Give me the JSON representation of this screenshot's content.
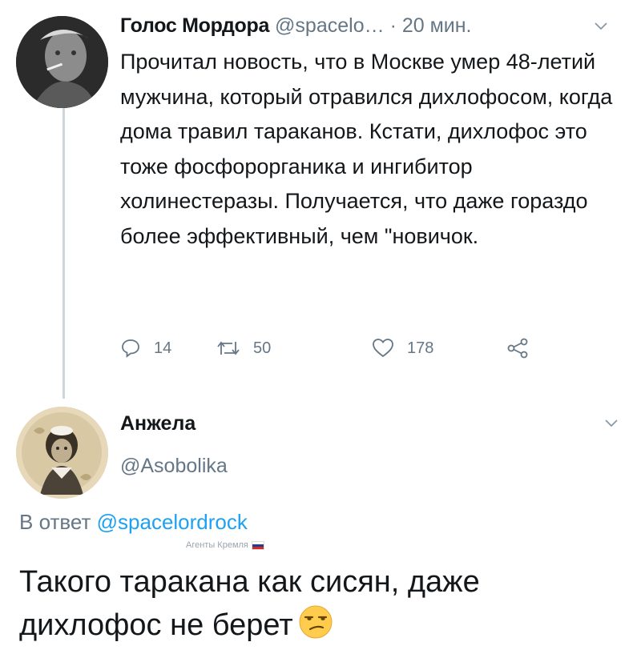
{
  "tweet1": {
    "author_name": "Голос Мордора",
    "handle": "@spacelo…",
    "time": "· 20 мин.",
    "body": "Прочитал новость, что в Москве умер 48-летий мужчина, который отравился дихлофосом, когда дома травил тараканов. Кстати, дихлофос это тоже фосфорорганика и ингибитор холинестеразы. Получается, что даже гораздо более эффективный, чем \"новичок.",
    "actions": {
      "replies": "14",
      "retweets": "50",
      "likes": "178"
    }
  },
  "tweet2": {
    "author_name": "Анжела",
    "handle": "@Asobolika",
    "reply_prefix": "В ответ",
    "reply_to": "@spacelordrock",
    "body": "Такого таракана как сисян, даже дихлофос не берет"
  },
  "watermark": {
    "text": "Агенты Кремля",
    "flag_colors": [
      "#ffffff",
      "#1c3f94",
      "#d52b1e"
    ]
  },
  "icons": {
    "reply": "reply-icon",
    "retweet": "retweet-icon",
    "like": "heart-icon",
    "share": "share-icon",
    "more": "chevron-down-icon",
    "emoji": "unamused-face-icon"
  },
  "colors": {
    "link": "#1da1f2",
    "secondary": "#657786",
    "text": "#14171a",
    "thread_line": "#ccd6dd"
  }
}
